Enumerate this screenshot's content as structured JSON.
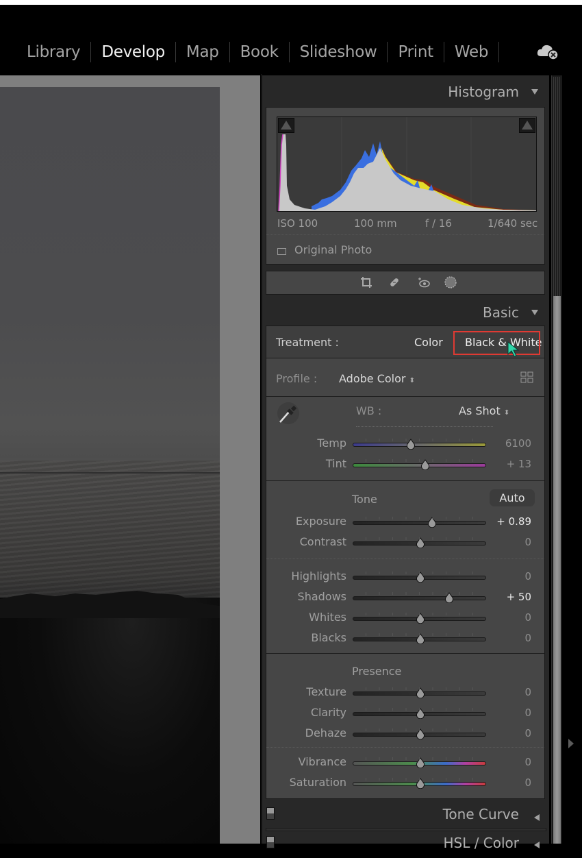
{
  "app": {
    "modules": [
      {
        "label": "Library",
        "active": false
      },
      {
        "label": "Develop",
        "active": true
      },
      {
        "label": "Map",
        "active": false
      },
      {
        "label": "Book",
        "active": false
      },
      {
        "label": "Slideshow",
        "active": false
      },
      {
        "label": "Print",
        "active": false
      },
      {
        "label": "Web",
        "active": false
      }
    ],
    "cloud_icon": "cloud-sync-error-icon"
  },
  "histogram": {
    "title": "Histogram",
    "exif": {
      "iso": "ISO 100",
      "focal": "100 mm",
      "aperture": "f / 16",
      "shutter": "1/640 sec"
    },
    "original_photo_label": "Original Photo",
    "tools": [
      "crop-icon",
      "healing-icon",
      "red-eye-icon",
      "masking-icon"
    ]
  },
  "basic": {
    "title": "Basic",
    "treatment": {
      "label": "Treatment :",
      "options": [
        "Color",
        "Black & White"
      ],
      "highlighted": "Black & White"
    },
    "profile": {
      "label": "Profile :",
      "value": "Adobe Color"
    },
    "wb": {
      "label": "WB :",
      "value": "As Shot"
    },
    "wb_sliders": [
      {
        "label": "Temp",
        "value": "6100",
        "position": 0.43,
        "bright": false,
        "track": "temp"
      },
      {
        "label": "Tint",
        "value": "+ 13",
        "position": 0.54,
        "bright": false,
        "track": "tint"
      }
    ],
    "tone_label": "Tone",
    "auto_label": "Auto",
    "tone_sliders": [
      {
        "label": "Exposure",
        "value": "+ 0.89",
        "position": 0.59,
        "bright": true
      },
      {
        "label": "Contrast",
        "value": "0",
        "position": 0.5,
        "bright": false
      }
    ],
    "tone_sliders2": [
      {
        "label": "Highlights",
        "value": "0",
        "position": 0.5,
        "bright": false
      },
      {
        "label": "Shadows",
        "value": "+ 50",
        "position": 0.72,
        "bright": true
      },
      {
        "label": "Whites",
        "value": "0",
        "position": 0.5,
        "bright": false
      },
      {
        "label": "Blacks",
        "value": "0",
        "position": 0.5,
        "bright": false
      }
    ],
    "presence_label": "Presence",
    "presence_sliders": [
      {
        "label": "Texture",
        "value": "0",
        "position": 0.5,
        "bright": false
      },
      {
        "label": "Clarity",
        "value": "0",
        "position": 0.5,
        "bright": false
      },
      {
        "label": "Dehaze",
        "value": "0",
        "position": 0.5,
        "bright": false
      }
    ],
    "color_sliders": [
      {
        "label": "Vibrance",
        "value": "0",
        "position": 0.5,
        "bright": false,
        "track": "vib"
      },
      {
        "label": "Saturation",
        "value": "0",
        "position": 0.5,
        "bright": false,
        "track": "vib"
      }
    ]
  },
  "collapsed_panels": [
    {
      "title": "Tone Curve"
    },
    {
      "title": "HSL / Color"
    }
  ],
  "colors": {
    "highlight": "#e03a33",
    "cursor": "#2fd4a8"
  }
}
